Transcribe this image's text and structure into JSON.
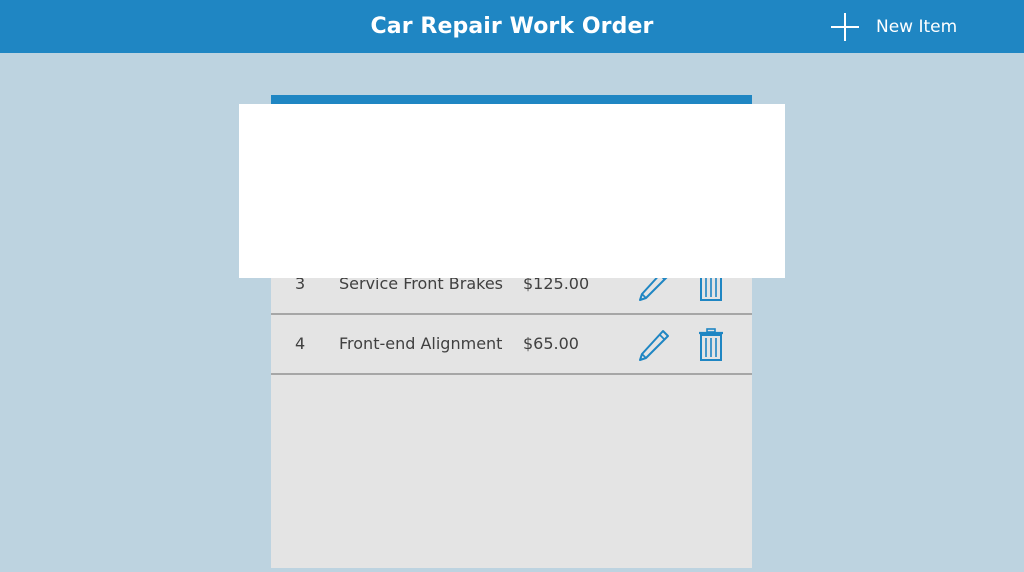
{
  "header": {
    "title": "Car Repair Work Order",
    "new_item_label": "New Item",
    "new_item_icon": "plus-icon"
  },
  "colors": {
    "header_bg": "#1f86c3",
    "page_bg": "#bdd3e0",
    "panel_bg": "#e4e4e4",
    "accent": "#1f86c3"
  },
  "items": [
    {
      "number": "3",
      "description": "Service Front Brakes",
      "price": "$125.00",
      "edit_icon": "pencil-icon",
      "delete_icon": "trash-icon"
    },
    {
      "number": "4",
      "description": "Front-end Alignment",
      "price": "$65.00",
      "edit_icon": "pencil-icon",
      "delete_icon": "trash-icon"
    }
  ]
}
